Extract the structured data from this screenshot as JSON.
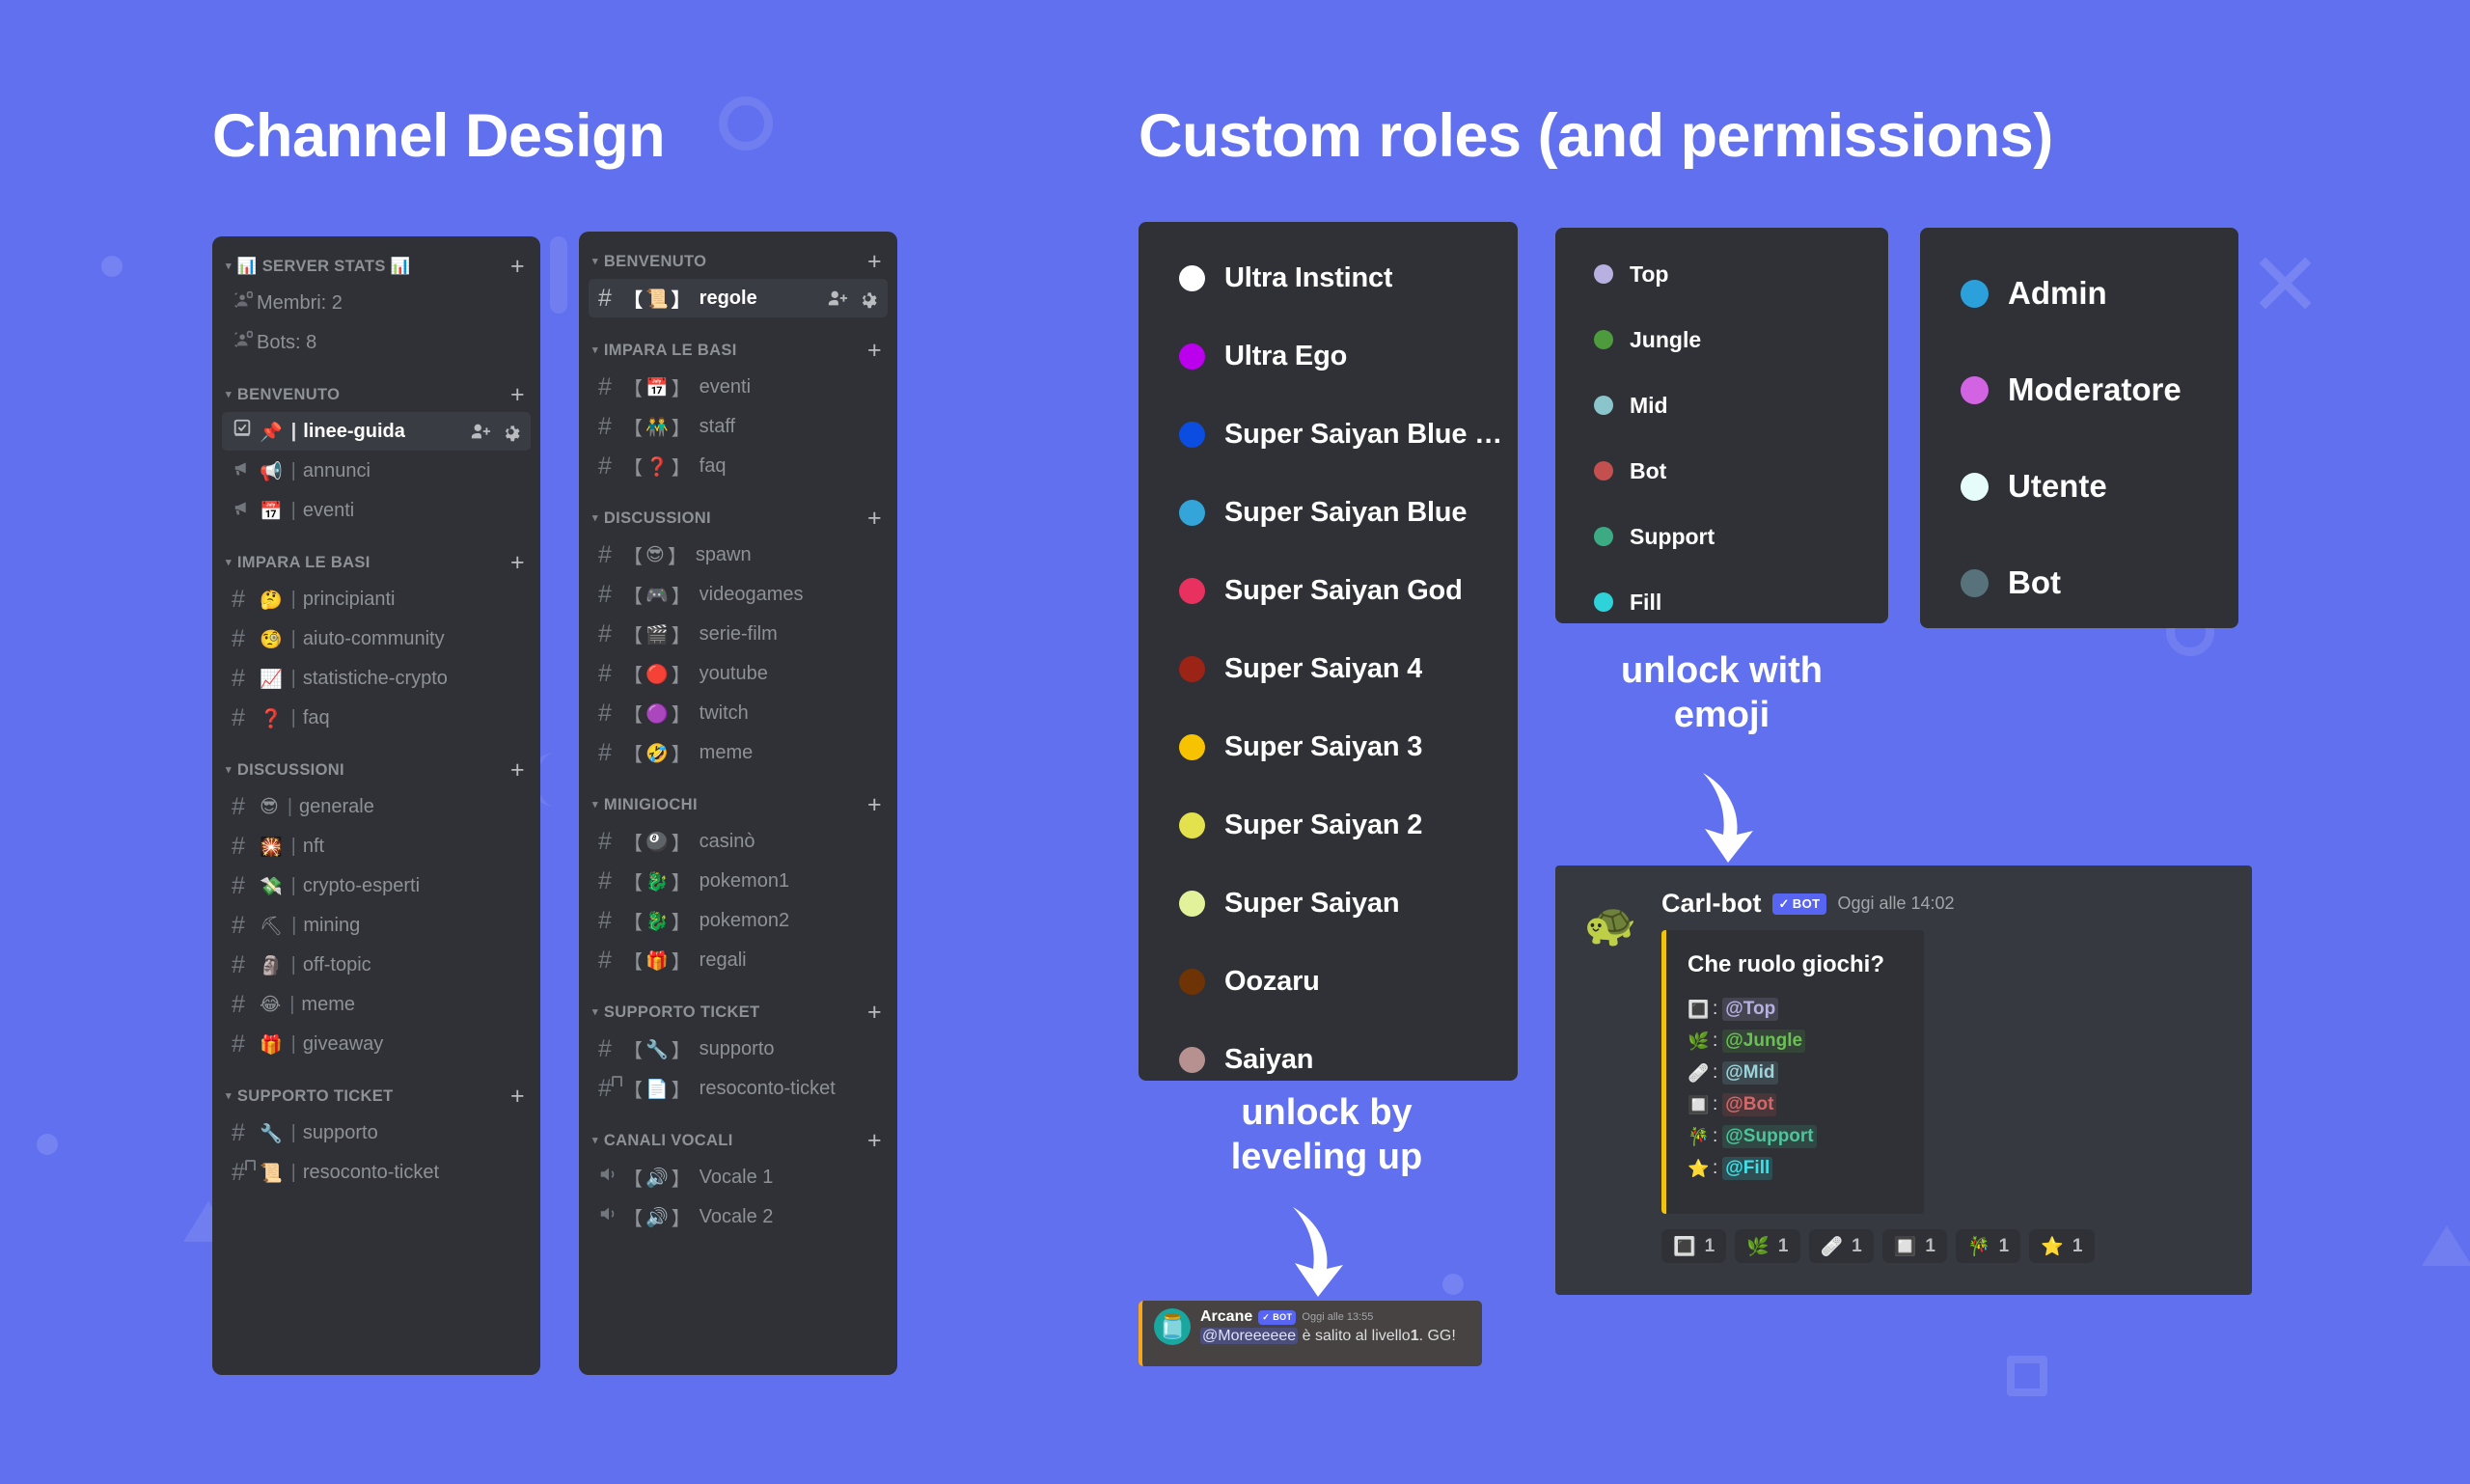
{
  "headings": {
    "channel_design": "Channel Design",
    "custom_roles": "Custom roles (and permissions)"
  },
  "annotations": {
    "unlock_leveling": "unlock by\nleveling up",
    "unlock_emoji": "unlock with\nemoji"
  },
  "sidebar_emoji": {
    "categories": [
      {
        "label": "📊 SERVER STATS 📊",
        "channels": [
          {
            "icon": "stats-voice-locked-icon",
            "emoji": "",
            "sep": false,
            "name": "Membri: 2",
            "active": false,
            "locked": true
          },
          {
            "icon": "stats-voice-locked-icon",
            "emoji": "",
            "sep": false,
            "name": "Bots: 8",
            "active": false,
            "locked": true
          }
        ]
      },
      {
        "label": "BENVENUTO",
        "channels": [
          {
            "icon": "rules-channel-icon",
            "emoji": "📌",
            "sep": true,
            "name": "linee-guida",
            "active": true,
            "locked": false
          },
          {
            "icon": "announcement-channel-icon",
            "emoji": "📢",
            "sep": true,
            "name": "annunci",
            "active": false,
            "locked": false
          },
          {
            "icon": "announcement-channel-icon",
            "emoji": "📅",
            "sep": true,
            "name": "eventi",
            "active": false,
            "locked": false
          }
        ]
      },
      {
        "label": "IMPARA LE BASI",
        "channels": [
          {
            "icon": "hash-icon",
            "emoji": "🤔",
            "sep": true,
            "name": "principianti",
            "active": false,
            "locked": false
          },
          {
            "icon": "hash-icon",
            "emoji": "🧐",
            "sep": true,
            "name": "aiuto-community",
            "active": false,
            "locked": false
          },
          {
            "icon": "hash-icon",
            "emoji": "📈",
            "sep": true,
            "name": "statistiche-crypto",
            "active": false,
            "locked": false
          },
          {
            "icon": "hash-icon",
            "emoji": "❓",
            "sep": true,
            "name": "faq",
            "active": false,
            "locked": false
          }
        ]
      },
      {
        "label": "DISCUSSIONI",
        "channels": [
          {
            "icon": "hash-icon",
            "emoji": "😎",
            "sep": true,
            "name": "generale",
            "active": false,
            "locked": false
          },
          {
            "icon": "hash-icon",
            "emoji": "🎇",
            "sep": true,
            "name": "nft",
            "active": false,
            "locked": false
          },
          {
            "icon": "hash-icon",
            "emoji": "💸",
            "sep": true,
            "name": "crypto-esperti",
            "active": false,
            "locked": false
          },
          {
            "icon": "hash-icon",
            "emoji": "⛏",
            "sep": true,
            "name": "mining",
            "active": false,
            "locked": false
          },
          {
            "icon": "hash-icon",
            "emoji": "🗿",
            "sep": true,
            "name": "off-topic",
            "active": false,
            "locked": false
          },
          {
            "icon": "hash-icon",
            "emoji": "😂",
            "sep": true,
            "name": "meme",
            "active": false,
            "locked": false
          },
          {
            "icon": "hash-icon",
            "emoji": "🎁",
            "sep": true,
            "name": "giveaway",
            "active": false,
            "locked": false
          }
        ]
      },
      {
        "label": "SUPPORTO TICKET",
        "channels": [
          {
            "icon": "hash-icon",
            "emoji": "🔧",
            "sep": true,
            "name": "supporto",
            "active": false,
            "locked": false
          },
          {
            "icon": "hash-icon",
            "emoji": "📜",
            "sep": true,
            "name": "resoconto-ticket",
            "active": false,
            "locked": true
          }
        ]
      }
    ]
  },
  "sidebar_bracket": {
    "categories": [
      {
        "label": "BENVENUTO",
        "channels": [
          {
            "emoji": "📜",
            "name": "regole",
            "active": true,
            "locked": false
          }
        ]
      },
      {
        "label": "IMPARA LE BASI",
        "channels": [
          {
            "emoji": "📅",
            "name": "eventi",
            "active": false,
            "locked": false
          },
          {
            "emoji": "👬",
            "name": "staff",
            "active": false,
            "locked": false
          },
          {
            "emoji": "❓",
            "name": "faq",
            "active": false,
            "locked": false
          }
        ]
      },
      {
        "label": "DISCUSSIONI",
        "channels": [
          {
            "emoji": "😎",
            "name": "spawn",
            "active": false,
            "locked": false
          },
          {
            "emoji": "🎮",
            "name": "videogames",
            "active": false,
            "locked": false
          },
          {
            "emoji": "🎬",
            "name": "serie-film",
            "active": false,
            "locked": false
          },
          {
            "emoji": "🔴",
            "name": "youtube",
            "active": false,
            "locked": false
          },
          {
            "emoji": "🟣",
            "name": "twitch",
            "active": false,
            "locked": false
          },
          {
            "emoji": "🤣",
            "name": "meme",
            "active": false,
            "locked": false
          }
        ]
      },
      {
        "label": "MINIGIOCHI",
        "channels": [
          {
            "emoji": "🎱",
            "name": "casinò",
            "active": false,
            "locked": false
          },
          {
            "emoji": "🐉",
            "name": "pokemon1",
            "active": false,
            "locked": false
          },
          {
            "emoji": "🐉",
            "name": "pokemon2",
            "active": false,
            "locked": false
          },
          {
            "emoji": "🎁",
            "name": "regali",
            "active": false,
            "locked": false
          }
        ]
      },
      {
        "label": "SUPPORTO TICKET",
        "channels": [
          {
            "emoji": "🔧",
            "name": "supporto",
            "active": false,
            "locked": false
          },
          {
            "emoji": "📄",
            "name": "resoconto-ticket",
            "active": false,
            "locked": true
          }
        ]
      },
      {
        "label": "CANALI VOCALI",
        "channels": [
          {
            "emoji": "🔊",
            "name": "Vocale 1",
            "active": false,
            "locked": false,
            "voice": true
          },
          {
            "emoji": "🔊",
            "name": "Vocale 2",
            "active": false,
            "locked": false,
            "voice": true
          }
        ]
      }
    ]
  },
  "roles_dragonball": [
    {
      "name": "Ultra Instinct",
      "color": "#ffffff"
    },
    {
      "name": "Ultra Ego",
      "color": "#bb00ee"
    },
    {
      "name": "Super Saiyan Blue Ev...",
      "color": "#0a4de0"
    },
    {
      "name": "Super Saiyan Blue",
      "color": "#34a5d8"
    },
    {
      "name": "Super Saiyan God",
      "color": "#e8315e"
    },
    {
      "name": "Super Saiyan 4",
      "color": "#9c2417"
    },
    {
      "name": "Super Saiyan 3",
      "color": "#f7c300"
    },
    {
      "name": "Super Saiyan 2",
      "color": "#e3e14c"
    },
    {
      "name": "Super Saiyan",
      "color": "#e2f29a"
    },
    {
      "name": "Oozaru",
      "color": "#6e3405"
    },
    {
      "name": "Saiyan",
      "color": "#b79090"
    }
  ],
  "roles_lol": [
    {
      "name": "Top",
      "color": "#b7b0e0"
    },
    {
      "name": "Jungle",
      "color": "#4e9b3e"
    },
    {
      "name": "Mid",
      "color": "#8ac5cc"
    },
    {
      "name": "Bot",
      "color": "#c44f4f"
    },
    {
      "name": "Support",
      "color": "#3cab84"
    },
    {
      "name": "Fill",
      "color": "#2ed3d9"
    }
  ],
  "roles_staff": [
    {
      "name": "Admin",
      "color": "#2ca0da"
    },
    {
      "name": "Moderatore",
      "color": "#d263e2"
    },
    {
      "name": "Utente",
      "color": "#e6fcfb"
    },
    {
      "name": "Bot",
      "color": "#58727c"
    }
  ],
  "carlbot": {
    "avatar_emoji": "🐢",
    "author": "Carl-bot",
    "bot_badge": "BOT",
    "timestamp": "Oggi alle 14:02",
    "embed_title": "Che ruolo giochi?",
    "embed_color": "#f1c40f",
    "embed_rows": [
      {
        "emoji": "🔳",
        "mention": "@Top",
        "color": "#b7b0e0",
        "bg": "rgba(183,176,224,0.16)"
      },
      {
        "emoji": "🌿",
        "mention": "@Jungle",
        "color": "#6bbf56",
        "bg": "rgba(78,155,62,0.18)"
      },
      {
        "emoji": "🩹",
        "mention": "@Mid",
        "color": "#9dd3da",
        "bg": "rgba(138,197,204,0.16)"
      },
      {
        "emoji": "🔲",
        "mention": "@Bot",
        "color": "#d06a6a",
        "bg": "rgba(196,79,79,0.18)"
      },
      {
        "emoji": "🎋",
        "mention": "@Support",
        "color": "#4ec49a",
        "bg": "rgba(60,171,132,0.18)"
      },
      {
        "emoji": "⭐",
        "mention": "@Fill",
        "color": "#3fe0e6",
        "bg": "rgba(46,211,217,0.18)"
      }
    ],
    "reactions": [
      {
        "emoji": "🔳",
        "count": "1"
      },
      {
        "emoji": "🌿",
        "count": "1"
      },
      {
        "emoji": "🩹",
        "count": "1"
      },
      {
        "emoji": "🔲",
        "count": "1"
      },
      {
        "emoji": "🎋",
        "count": "1"
      },
      {
        "emoji": "⭐",
        "count": "1"
      }
    ]
  },
  "arcane": {
    "avatar_emoji": "🫙",
    "author": "Arcane",
    "bot_badge": "BOT",
    "timestamp": "Oggi alle 13:55",
    "mention": "@Moreeeeee",
    "text_part1": " è salito al livello",
    "level": "1",
    "text_part2": ". GG!"
  }
}
